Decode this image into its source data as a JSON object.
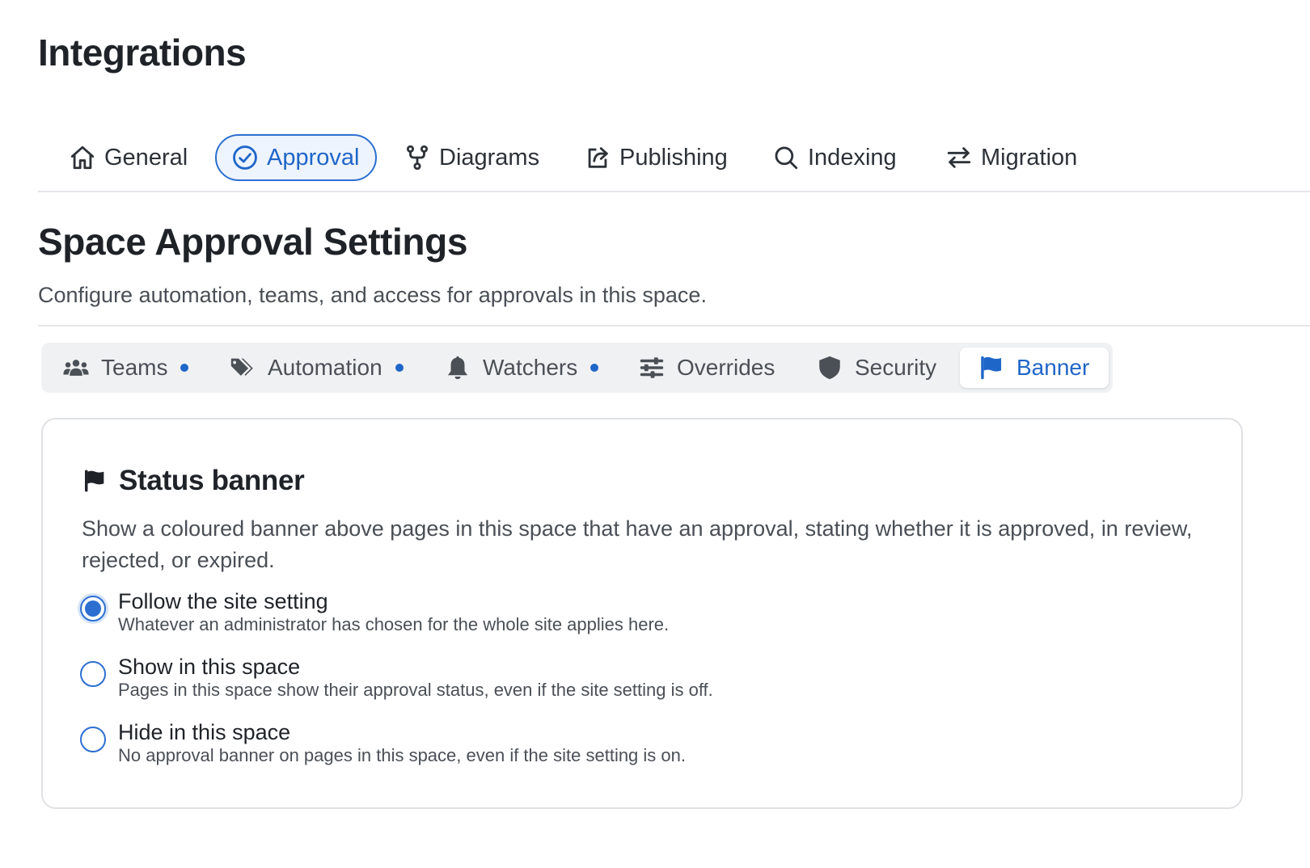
{
  "page": {
    "title": "Integrations"
  },
  "main_tabs": [
    {
      "label": "General",
      "icon": "home-icon"
    },
    {
      "label": "Approval",
      "icon": "check-circle-icon",
      "active": true
    },
    {
      "label": "Diagrams",
      "icon": "fork-icon"
    },
    {
      "label": "Publishing",
      "icon": "share-icon"
    },
    {
      "label": "Indexing",
      "icon": "search-icon"
    },
    {
      "label": "Migration",
      "icon": "arrows-swap-icon"
    }
  ],
  "section": {
    "title": "Space Approval Settings",
    "description": "Configure automation, teams, and access for approvals in this space."
  },
  "sub_tabs": [
    {
      "label": "Teams",
      "icon": "users-icon",
      "dot": true
    },
    {
      "label": "Automation",
      "icon": "tags-icon",
      "dot": true
    },
    {
      "label": "Watchers",
      "icon": "bell-icon",
      "dot": true
    },
    {
      "label": "Overrides",
      "icon": "sliders-icon",
      "dot": false
    },
    {
      "label": "Security",
      "icon": "shield-icon",
      "dot": false
    },
    {
      "label": "Banner",
      "icon": "flag-icon",
      "dot": false,
      "active": true
    }
  ],
  "colors": {
    "accent": "#2c6fd1",
    "dot": "#1f66c9",
    "text": "#1f2328",
    "muted": "#4a4f56"
  },
  "card": {
    "title": "Status banner",
    "icon": "flag-icon",
    "description": "Show a coloured banner above pages in this space that have an approval, stating whether it is approved, in review, rejected, or expired.",
    "options": [
      {
        "label": "Follow the site setting",
        "help": "Whatever an administrator has chosen for the whole site applies here.",
        "checked": true
      },
      {
        "label": "Show in this space",
        "help": "Pages in this space show their approval status, even if the site setting is off.",
        "checked": false
      },
      {
        "label": "Hide in this space",
        "help": "No approval banner on pages in this space, even if the site setting is on.",
        "checked": false
      }
    ]
  }
}
